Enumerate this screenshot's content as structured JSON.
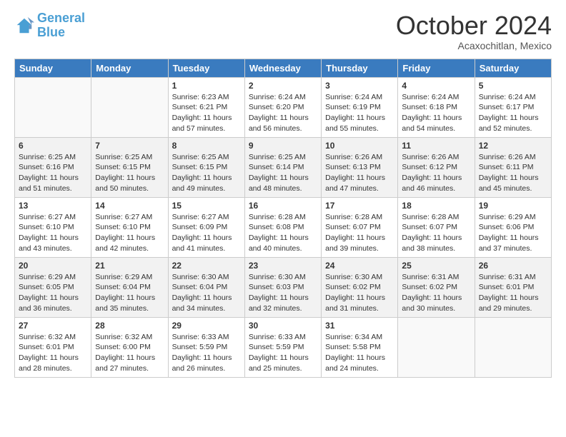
{
  "logo": {
    "line1": "General",
    "line2": "Blue"
  },
  "title": "October 2024",
  "location": "Acaxochitlan, Mexico",
  "days_header": [
    "Sunday",
    "Monday",
    "Tuesday",
    "Wednesday",
    "Thursday",
    "Friday",
    "Saturday"
  ],
  "weeks": [
    [
      {
        "num": "",
        "sunrise": "",
        "sunset": "",
        "daylight": ""
      },
      {
        "num": "",
        "sunrise": "",
        "sunset": "",
        "daylight": ""
      },
      {
        "num": "1",
        "sunrise": "Sunrise: 6:23 AM",
        "sunset": "Sunset: 6:21 PM",
        "daylight": "Daylight: 11 hours and 57 minutes."
      },
      {
        "num": "2",
        "sunrise": "Sunrise: 6:24 AM",
        "sunset": "Sunset: 6:20 PM",
        "daylight": "Daylight: 11 hours and 56 minutes."
      },
      {
        "num": "3",
        "sunrise": "Sunrise: 6:24 AM",
        "sunset": "Sunset: 6:19 PM",
        "daylight": "Daylight: 11 hours and 55 minutes."
      },
      {
        "num": "4",
        "sunrise": "Sunrise: 6:24 AM",
        "sunset": "Sunset: 6:18 PM",
        "daylight": "Daylight: 11 hours and 54 minutes."
      },
      {
        "num": "5",
        "sunrise": "Sunrise: 6:24 AM",
        "sunset": "Sunset: 6:17 PM",
        "daylight": "Daylight: 11 hours and 52 minutes."
      }
    ],
    [
      {
        "num": "6",
        "sunrise": "Sunrise: 6:25 AM",
        "sunset": "Sunset: 6:16 PM",
        "daylight": "Daylight: 11 hours and 51 minutes."
      },
      {
        "num": "7",
        "sunrise": "Sunrise: 6:25 AM",
        "sunset": "Sunset: 6:15 PM",
        "daylight": "Daylight: 11 hours and 50 minutes."
      },
      {
        "num": "8",
        "sunrise": "Sunrise: 6:25 AM",
        "sunset": "Sunset: 6:15 PM",
        "daylight": "Daylight: 11 hours and 49 minutes."
      },
      {
        "num": "9",
        "sunrise": "Sunrise: 6:25 AM",
        "sunset": "Sunset: 6:14 PM",
        "daylight": "Daylight: 11 hours and 48 minutes."
      },
      {
        "num": "10",
        "sunrise": "Sunrise: 6:26 AM",
        "sunset": "Sunset: 6:13 PM",
        "daylight": "Daylight: 11 hours and 47 minutes."
      },
      {
        "num": "11",
        "sunrise": "Sunrise: 6:26 AM",
        "sunset": "Sunset: 6:12 PM",
        "daylight": "Daylight: 11 hours and 46 minutes."
      },
      {
        "num": "12",
        "sunrise": "Sunrise: 6:26 AM",
        "sunset": "Sunset: 6:11 PM",
        "daylight": "Daylight: 11 hours and 45 minutes."
      }
    ],
    [
      {
        "num": "13",
        "sunrise": "Sunrise: 6:27 AM",
        "sunset": "Sunset: 6:10 PM",
        "daylight": "Daylight: 11 hours and 43 minutes."
      },
      {
        "num": "14",
        "sunrise": "Sunrise: 6:27 AM",
        "sunset": "Sunset: 6:10 PM",
        "daylight": "Daylight: 11 hours and 42 minutes."
      },
      {
        "num": "15",
        "sunrise": "Sunrise: 6:27 AM",
        "sunset": "Sunset: 6:09 PM",
        "daylight": "Daylight: 11 hours and 41 minutes."
      },
      {
        "num": "16",
        "sunrise": "Sunrise: 6:28 AM",
        "sunset": "Sunset: 6:08 PM",
        "daylight": "Daylight: 11 hours and 40 minutes."
      },
      {
        "num": "17",
        "sunrise": "Sunrise: 6:28 AM",
        "sunset": "Sunset: 6:07 PM",
        "daylight": "Daylight: 11 hours and 39 minutes."
      },
      {
        "num": "18",
        "sunrise": "Sunrise: 6:28 AM",
        "sunset": "Sunset: 6:07 PM",
        "daylight": "Daylight: 11 hours and 38 minutes."
      },
      {
        "num": "19",
        "sunrise": "Sunrise: 6:29 AM",
        "sunset": "Sunset: 6:06 PM",
        "daylight": "Daylight: 11 hours and 37 minutes."
      }
    ],
    [
      {
        "num": "20",
        "sunrise": "Sunrise: 6:29 AM",
        "sunset": "Sunset: 6:05 PM",
        "daylight": "Daylight: 11 hours and 36 minutes."
      },
      {
        "num": "21",
        "sunrise": "Sunrise: 6:29 AM",
        "sunset": "Sunset: 6:04 PM",
        "daylight": "Daylight: 11 hours and 35 minutes."
      },
      {
        "num": "22",
        "sunrise": "Sunrise: 6:30 AM",
        "sunset": "Sunset: 6:04 PM",
        "daylight": "Daylight: 11 hours and 34 minutes."
      },
      {
        "num": "23",
        "sunrise": "Sunrise: 6:30 AM",
        "sunset": "Sunset: 6:03 PM",
        "daylight": "Daylight: 11 hours and 32 minutes."
      },
      {
        "num": "24",
        "sunrise": "Sunrise: 6:30 AM",
        "sunset": "Sunset: 6:02 PM",
        "daylight": "Daylight: 11 hours and 31 minutes."
      },
      {
        "num": "25",
        "sunrise": "Sunrise: 6:31 AM",
        "sunset": "Sunset: 6:02 PM",
        "daylight": "Daylight: 11 hours and 30 minutes."
      },
      {
        "num": "26",
        "sunrise": "Sunrise: 6:31 AM",
        "sunset": "Sunset: 6:01 PM",
        "daylight": "Daylight: 11 hours and 29 minutes."
      }
    ],
    [
      {
        "num": "27",
        "sunrise": "Sunrise: 6:32 AM",
        "sunset": "Sunset: 6:01 PM",
        "daylight": "Daylight: 11 hours and 28 minutes."
      },
      {
        "num": "28",
        "sunrise": "Sunrise: 6:32 AM",
        "sunset": "Sunset: 6:00 PM",
        "daylight": "Daylight: 11 hours and 27 minutes."
      },
      {
        "num": "29",
        "sunrise": "Sunrise: 6:33 AM",
        "sunset": "Sunset: 5:59 PM",
        "daylight": "Daylight: 11 hours and 26 minutes."
      },
      {
        "num": "30",
        "sunrise": "Sunrise: 6:33 AM",
        "sunset": "Sunset: 5:59 PM",
        "daylight": "Daylight: 11 hours and 25 minutes."
      },
      {
        "num": "31",
        "sunrise": "Sunrise: 6:34 AM",
        "sunset": "Sunset: 5:58 PM",
        "daylight": "Daylight: 11 hours and 24 minutes."
      },
      {
        "num": "",
        "sunrise": "",
        "sunset": "",
        "daylight": ""
      },
      {
        "num": "",
        "sunrise": "",
        "sunset": "",
        "daylight": ""
      }
    ]
  ]
}
